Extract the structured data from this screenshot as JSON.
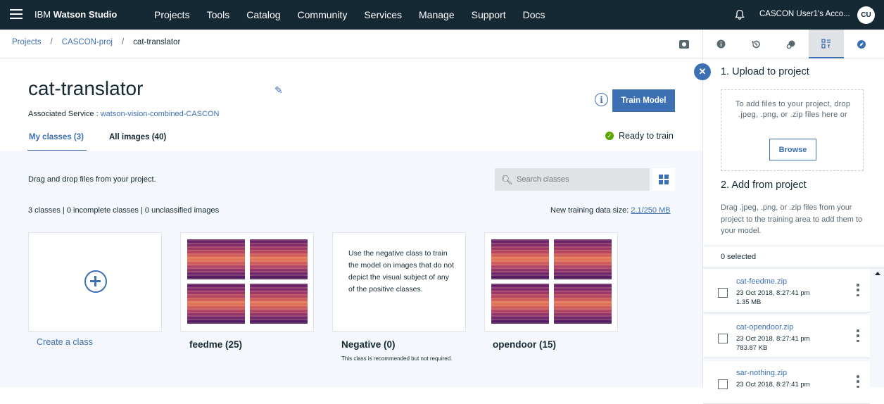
{
  "topbar": {
    "brand_prefix": "IBM",
    "brand_name": "Watson Studio",
    "nav": [
      "Projects",
      "Tools",
      "Catalog",
      "Community",
      "Services",
      "Manage",
      "Support",
      "Docs"
    ],
    "account": "CASCON User1's Acco...",
    "avatar": "CU"
  },
  "breadcrumb": {
    "items": [
      "Projects",
      "CASCON-proj",
      "cat-translator"
    ],
    "separator": "/"
  },
  "model": {
    "title": "cat-translator",
    "assoc_label": "Associated Service : ",
    "assoc_link": "watson-vision-combined-CASCON",
    "info_glyph": "i",
    "train_button": "Train Model",
    "status": "Ready to train"
  },
  "tabs": {
    "my_classes": "My classes (3)",
    "all_images": "All images (40)"
  },
  "content": {
    "drag_text": "Drag and drop files from your project.",
    "search_placeholder": "Search classes",
    "stats": "3 classes | 0 incomplete classes | 0 unclassified images",
    "training_size_label": "New training data size: ",
    "training_size_value": "2.1/250 MB",
    "create_class": "Create a class",
    "negative_desc": "Use the negative class to train the model on images that do not depict the visual subject of any of the positive classes.",
    "classes": [
      {
        "label": "feedme (25)"
      },
      {
        "label": "Negative (0)",
        "note": "This class is recommended but not required."
      },
      {
        "label": "opendoor (15)"
      }
    ]
  },
  "panel": {
    "tabs": [
      "info-icon",
      "history-icon",
      "connect-icon",
      "data-icon",
      "compass-icon"
    ],
    "active_tab": 3,
    "upload_heading": "1. Upload to project",
    "upload_text": "To add files to your project, drop .jpeg, .png, or .zip files here or",
    "browse": "Browse",
    "add_heading": "2. Add from project",
    "add_text": "Drag .jpeg, .png, or .zip files from your project to the training area to add them to your model.",
    "selected": "0 selected",
    "files": [
      {
        "name": "cat-feedme.zip",
        "date": "23 Oct 2018, 8:27:41 pm",
        "size": "1.35 MB"
      },
      {
        "name": "cat-opendoor.zip",
        "date": "23 Oct 2018, 8:27:41 pm",
        "size": "783.87 KB"
      },
      {
        "name": "sar-nothing.zip",
        "date": "23 Oct 2018, 8:27:41 pm",
        "size": ""
      }
    ]
  },
  "colors": {
    "topbar": "#152935",
    "accent": "#3d70b2",
    "ready": "#5aa700"
  }
}
